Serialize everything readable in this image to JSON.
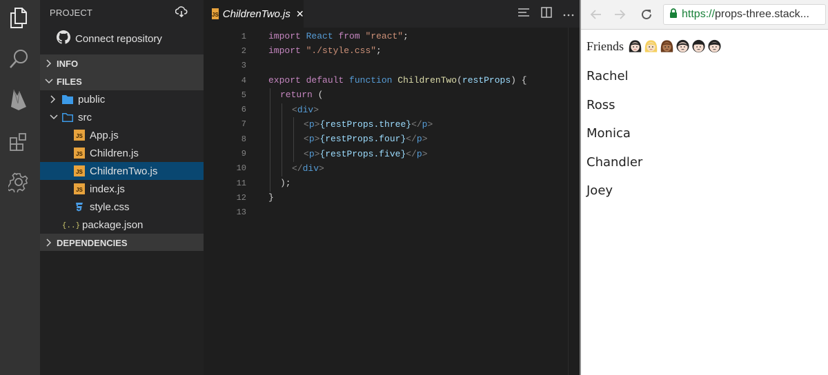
{
  "activity_bar": {
    "items": [
      {
        "name": "explorer"
      },
      {
        "name": "search"
      },
      {
        "name": "firebase"
      },
      {
        "name": "extensions"
      },
      {
        "name": "settings"
      }
    ]
  },
  "sidebar": {
    "title": "PROJECT",
    "connect_label": "Connect repository",
    "sections": {
      "info": "INFO",
      "files": "FILES",
      "dependencies": "DEPENDENCIES"
    },
    "tree": [
      {
        "label": "public",
        "type": "folder",
        "expanded": false
      },
      {
        "label": "src",
        "type": "folder",
        "expanded": true
      },
      {
        "label": "App.js",
        "type": "js"
      },
      {
        "label": "Children.js",
        "type": "js"
      },
      {
        "label": "ChildrenTwo.js",
        "type": "js",
        "selected": true
      },
      {
        "label": "index.js",
        "type": "js"
      },
      {
        "label": "style.css",
        "type": "css"
      },
      {
        "label": "package.json",
        "type": "json"
      }
    ]
  },
  "editor": {
    "tab": {
      "label": "ChildrenTwo.js",
      "close": "✕",
      "badge": "JS"
    },
    "line_numbers": [
      "1",
      "2",
      "3",
      "4",
      "5",
      "6",
      "7",
      "8",
      "9",
      "10",
      "11",
      "12",
      "13"
    ],
    "code": {
      "l1": [
        "import",
        " ",
        "React",
        " ",
        "from",
        " ",
        "\"react\"",
        ";"
      ],
      "l2": [
        "import",
        " ",
        "\"./style.css\"",
        ";"
      ],
      "l4": [
        "export",
        " ",
        "default",
        " ",
        "function",
        " ",
        "ChildrenTwo",
        "(",
        "restProps",
        ") {"
      ],
      "l5": [
        "return",
        " ("
      ],
      "l6": [
        "<",
        "div",
        ">"
      ],
      "l7": [
        "<",
        "p",
        ">",
        "{restProps.three}",
        "</",
        "p",
        ">"
      ],
      "l8": [
        "<",
        "p",
        ">",
        "{restProps.four}",
        "</",
        "p",
        ">"
      ],
      "l9": [
        "<",
        "p",
        ">",
        "{restProps.five}",
        "</",
        "p",
        ">"
      ],
      "l10": [
        "</",
        "div",
        ">"
      ],
      "l11": [
        ");"
      ],
      "l12": [
        "}"
      ]
    }
  },
  "browser": {
    "url_scheme": "https://",
    "url_rest": "props-three.stack...",
    "page": {
      "heading": "Friends",
      "emojis": [
        "woman-light-dark-hair",
        "woman-blond",
        "woman-medium-skin",
        "man-light",
        "man-light-2",
        "man-light-3"
      ],
      "friends": [
        "Rachel",
        "Ross",
        "Monica",
        "Chandler",
        "Joey"
      ]
    }
  },
  "colors": {
    "selected": "#094771",
    "js_badge": "#e8a33d",
    "folder": "#3c9ae8",
    "css": "#4a9ee8",
    "https": "#188038"
  }
}
